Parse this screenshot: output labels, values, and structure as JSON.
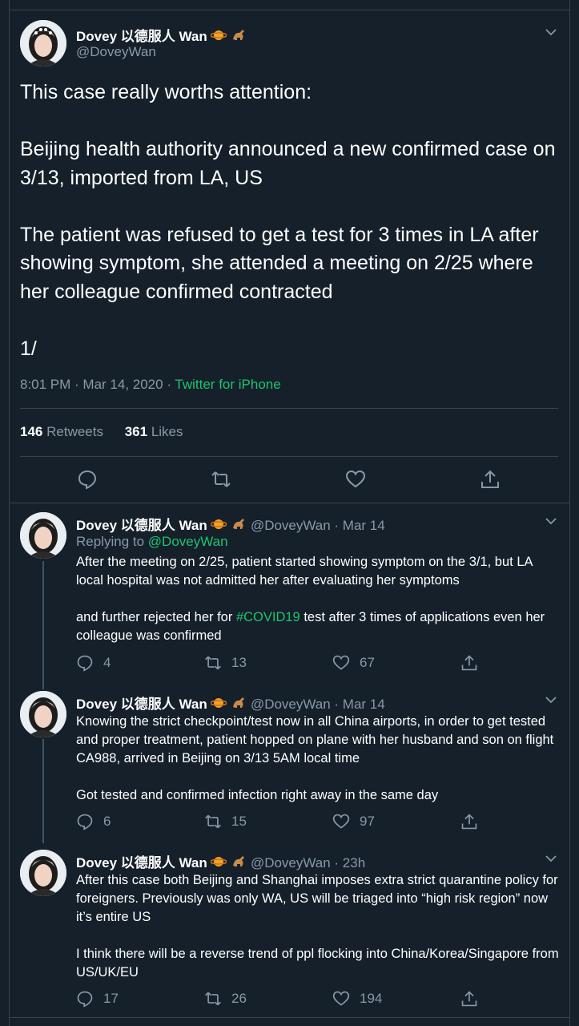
{
  "main_tweet": {
    "display_name": "Dovey 以德服人 Wan",
    "handle": "@DoveyWan",
    "text": "This case really worths attention:\n\nBeijing health authority announced a new confirmed case on 3/13, imported from LA, US\n\nThe patient was refused to get a test for 3 times in LA after showing symptom, she attended a meeting on 2/25 where her colleague confirmed contracted\n\n1/",
    "time": "8:01 PM · Mar 14, 2020 · ",
    "source": "Twitter for iPhone",
    "retweets_count": "146",
    "retweets_label": "Retweets",
    "likes_count": "361",
    "likes_label": "Likes"
  },
  "replies": [
    {
      "display_name": "Dovey 以德服人 Wan",
      "handle_time": "@DoveyWan · Mar 14",
      "replying_prefix": "Replying to ",
      "replying_to": "@DoveyWan",
      "text_a": "After the meeting on 2/25, patient started showing symptom on the 3/1, but LA local hospital was not admitted her after evaluating her symptoms\n\nand further rejected her for ",
      "hashtag": "#COVID19",
      "text_b": " test after 3 times of applications even her colleague was confirmed",
      "replies": "4",
      "retweets": "13",
      "likes": "67"
    },
    {
      "display_name": "Dovey 以德服人 Wan",
      "handle_time": "@DoveyWan · Mar 14",
      "text": "Knowing the strict checkpoint/test now in all China airports, in order to get tested and proper treatment, patient hopped on plane with her husband and son on flight CA988, arrived in Beijing on 3/13 5AM local time\n\nGot tested and confirmed infection right away in the same day",
      "replies": "6",
      "retweets": "15",
      "likes": "97"
    },
    {
      "display_name": "Dovey 以德服人 Wan",
      "handle_time": "@DoveyWan · 23h",
      "text": "After this case both Beijing and Shanghai imposes extra strict quarantine policy for foreigners. Previously was only WA, US will be triaged into “high risk region” now it’s entire US\n\nI think there will be a reverse trend of ppl flocking into China/Korea/Singapore from US/UK/EU",
      "replies": "17",
      "retweets": "26",
      "likes": "194"
    }
  ],
  "emoji_names": [
    "planet-emoji",
    "dinosaur-emoji"
  ],
  "colors": {
    "background": "#15202b",
    "accent_green": "#1ec46a",
    "muted": "#8899a6",
    "border": "#38444d"
  }
}
